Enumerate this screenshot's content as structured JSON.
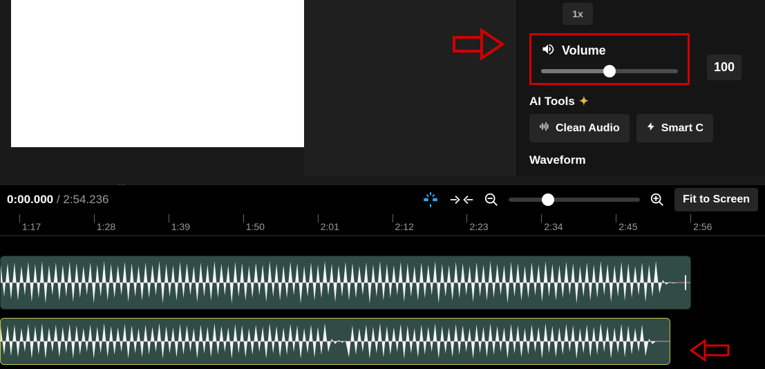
{
  "top_row": {
    "speed": "1x"
  },
  "volume": {
    "label": "Volume",
    "value": "100"
  },
  "ai": {
    "title": "AI Tools",
    "clean": "Clean Audio",
    "smart": "Smart C"
  },
  "waveform_label": "Waveform",
  "time": {
    "current": "0:00.000",
    "total": "2:54.236"
  },
  "fit_label": "Fit to Screen",
  "ruler": [
    "1:17",
    "1:28",
    "1:39",
    "1:50",
    "2:01",
    "2:12",
    "2:23",
    "2:34",
    "2:45",
    "2:56"
  ]
}
